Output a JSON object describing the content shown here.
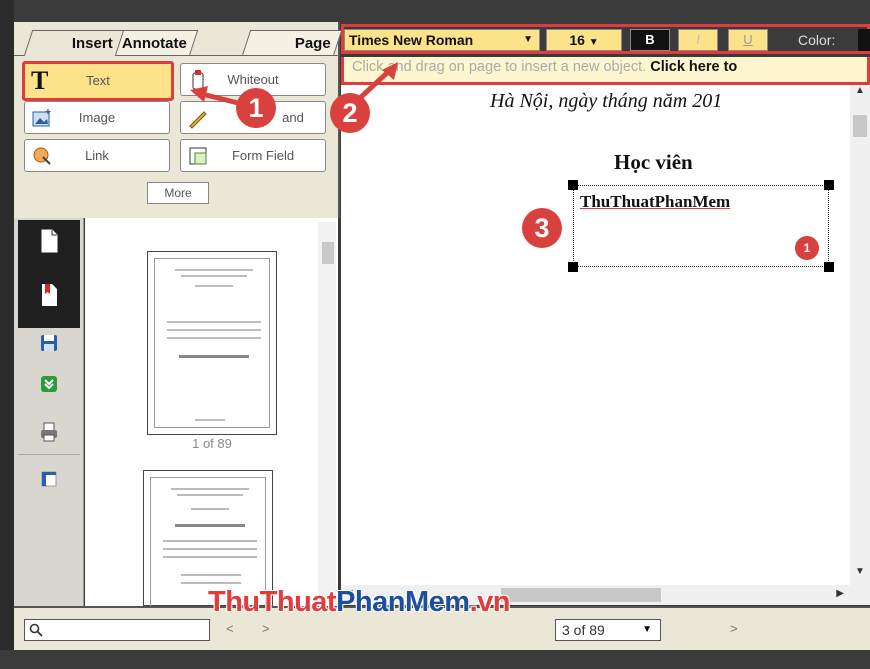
{
  "tabs": [
    {
      "label": "Insert"
    },
    {
      "label": "Annotate"
    },
    {
      "label": "Page"
    }
  ],
  "tools": [
    {
      "label": "Text",
      "icon": "text-tool-icon"
    },
    {
      "label": "Whiteout",
      "icon": "whiteout-icon"
    },
    {
      "label": "Image",
      "icon": "image-icon"
    },
    {
      "label": "and",
      "icon": "freehand-icon"
    },
    {
      "label": "Link",
      "icon": "link-icon"
    },
    {
      "label": "Form Field",
      "icon": "form-field-icon"
    }
  ],
  "more_label": "More",
  "format": {
    "font": "Times New Roman",
    "size": "16",
    "bold": "B",
    "italic": "I",
    "underline": "U",
    "color_label": "Color:"
  },
  "hint": {
    "text": "Click and drag on page to insert a new object. ",
    "link": "Click here to"
  },
  "document": {
    "date_line": "Hà Nội, ngày       tháng     năm 201",
    "heading": "Học viên",
    "textbox_text": "ThuThuatPhanMem",
    "badge": "1"
  },
  "thumbnails": {
    "caption": "1 of 89"
  },
  "bottom": {
    "page_select": "3 of 89",
    "prev": "<",
    "next": ">",
    "next2": ">"
  },
  "watermark": {
    "part1": "ThuThuat",
    "part2": "PhanMem",
    "part3": ".vn"
  },
  "callouts": [
    "1",
    "2",
    "3"
  ],
  "colors": {
    "accent_red": "#e23b3b",
    "active_yellow": "#fce38a",
    "panel_beige": "#ebe7d6",
    "watermark_blue": "#1d4f9c"
  }
}
